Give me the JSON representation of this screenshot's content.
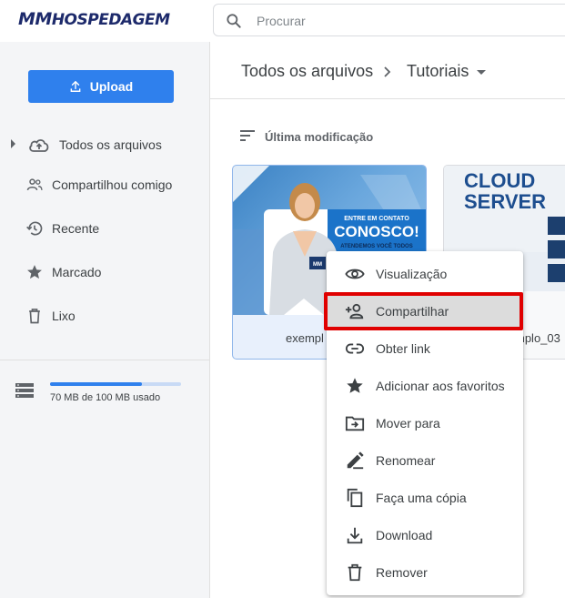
{
  "brand": {
    "logo_text": "MMHOSPEDAGEM"
  },
  "search": {
    "placeholder": "Procurar"
  },
  "sidebar": {
    "upload_label": "Upload",
    "items": [
      {
        "label": "Todos os arquivos",
        "icon": "cloud-upload-icon"
      },
      {
        "label": "Compartilhou comigo",
        "icon": "people-icon"
      },
      {
        "label": "Recente",
        "icon": "history-icon"
      },
      {
        "label": "Marcado",
        "icon": "star-icon"
      },
      {
        "label": "Lixo",
        "icon": "trash-icon"
      }
    ],
    "storage": {
      "text": "70 MB de 100 MB usado",
      "used_fraction": 0.7
    }
  },
  "breadcrumb": {
    "root": "Todos os arquivos",
    "current": "Tutoriais"
  },
  "sort": {
    "label": "Última modificação"
  },
  "files": [
    {
      "name": "exempl",
      "thumb_text_1": "ENTRE EM CONTATO",
      "thumb_text_2": "CONOSCO!",
      "thumb_text_3": "ATENDEMOS VOCÊ TODOS"
    },
    {
      "name": "mplo_03",
      "thumb_text_1": "CLOUD",
      "thumb_text_2": "SERVER"
    }
  ],
  "context_menu": {
    "items": [
      {
        "label": "Visualização",
        "icon": "eye-icon"
      },
      {
        "label": "Compartilhar",
        "icon": "person-add-icon",
        "highlighted": true
      },
      {
        "label": "Obter link",
        "icon": "link-icon"
      },
      {
        "label": "Adicionar aos favoritos",
        "icon": "star-icon"
      },
      {
        "label": "Mover para",
        "icon": "folder-move-icon"
      },
      {
        "label": "Renomear",
        "icon": "pencil-icon"
      },
      {
        "label": "Faça uma cópia",
        "icon": "copy-icon"
      },
      {
        "label": "Download",
        "icon": "download-icon"
      },
      {
        "label": "Remover",
        "icon": "trash-icon"
      }
    ]
  },
  "colors": {
    "accent": "#2f80ed",
    "highlight_border": "#e00000",
    "logo": "#1d2a6b"
  }
}
